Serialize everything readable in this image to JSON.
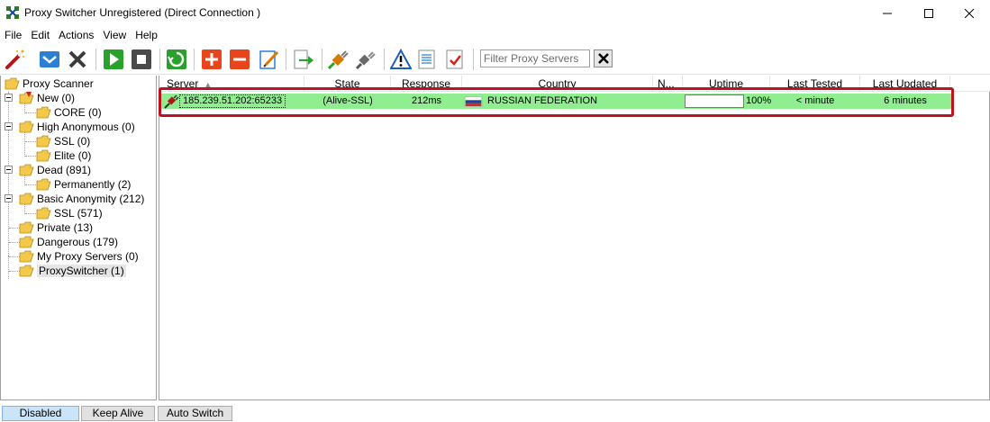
{
  "window": {
    "title": "Proxy Switcher Unregistered (Direct Connection )"
  },
  "menu": [
    "File",
    "Edit",
    "Actions",
    "View",
    "Help"
  ],
  "toolbar": {
    "buttons": [
      "wizard-icon",
      "mail-icon",
      "delete-icon",
      "play-icon",
      "stop-icon",
      "refresh-icon",
      "add-icon",
      "remove-icon",
      "edit-icon",
      "export-icon",
      "connect-icon",
      "disconnect-icon",
      "warning-icon",
      "document-icon",
      "checklist-icon"
    ],
    "filter_placeholder": "Filter Proxy Servers",
    "filter_value": ""
  },
  "tree": {
    "root": "Proxy Scanner",
    "nodes": [
      {
        "label": "New (0)"
      },
      {
        "label": "CORE (0)"
      },
      {
        "label": "High Anonymous (0)"
      },
      {
        "label": "SSL (0)"
      },
      {
        "label": "Elite (0)"
      },
      {
        "label": "Dead (891)"
      },
      {
        "label": "Permanently (2)"
      },
      {
        "label": "Basic Anonymity (212)"
      },
      {
        "label": "SSL (571)"
      },
      {
        "label": "Private (13)"
      },
      {
        "label": "Dangerous (179)"
      },
      {
        "label": "My Proxy Servers (0)"
      },
      {
        "label": "ProxySwitcher (1)"
      }
    ]
  },
  "list": {
    "columns": [
      "Server",
      "State",
      "Response",
      "Country",
      "N...",
      "Uptime",
      "Last Tested",
      "Last Updated"
    ],
    "rows": [
      {
        "server": "185.239.51.202:65233",
        "state": "(Alive-SSL)",
        "response": "212ms",
        "country": "RUSSIAN FEDERATION",
        "n": "",
        "uptime": "100%",
        "uptime_fraction": 0.0,
        "last_tested": "< minute",
        "last_updated": "6 minutes"
      }
    ]
  },
  "statusbar": {
    "buttons": [
      "Disabled",
      "Keep Alive",
      "Auto Switch"
    ]
  },
  "colors": {
    "row_alive": "#90ee90",
    "highlight": "#c0121e",
    "status_active": "#cce4f7"
  }
}
